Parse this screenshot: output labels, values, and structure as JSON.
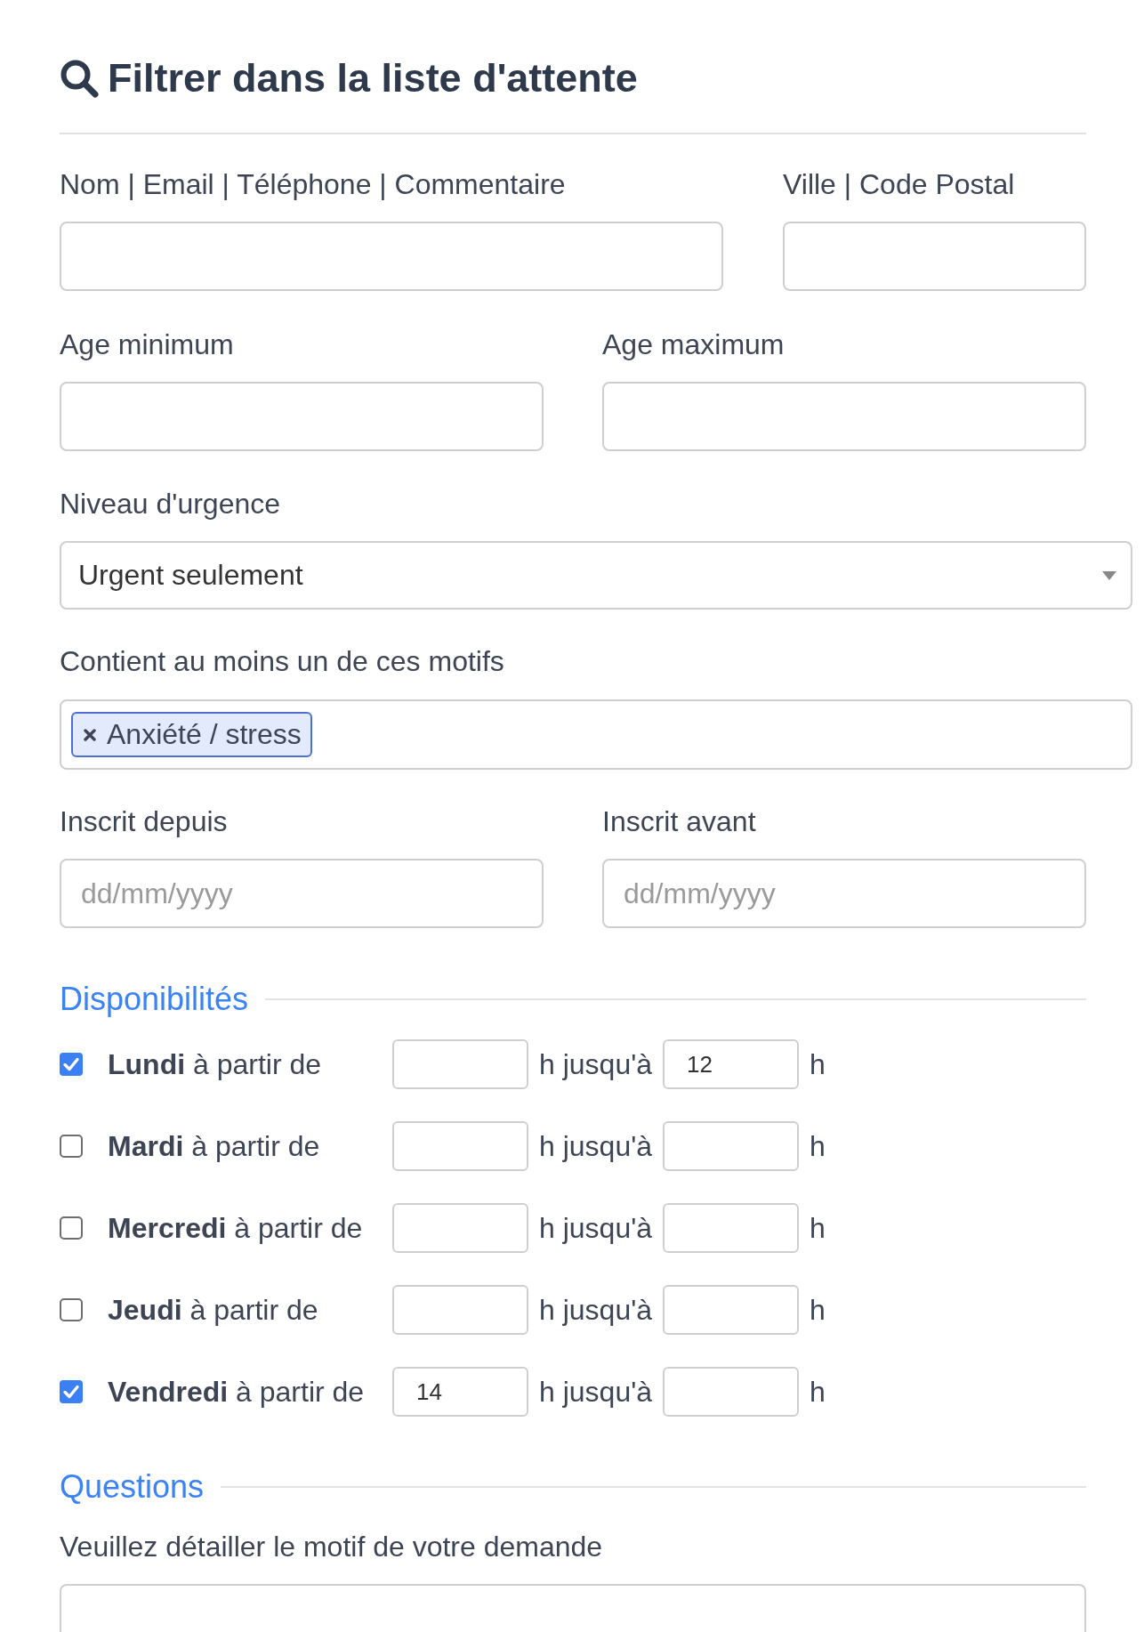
{
  "heading": {
    "title": "Filtrer dans la liste d'attente"
  },
  "search_row": [
    {
      "label": "Nom | Email | Téléphone | Commentaire"
    },
    {
      "label": "Ville | Code Postal"
    }
  ],
  "age_row": [
    {
      "label": "Age minimum"
    },
    {
      "label": "Age maximum"
    }
  ],
  "urgency": {
    "label": "Niveau d'urgence",
    "value": "Urgent seulement"
  },
  "motifs": {
    "label": "Contient au moins un de ces motifs",
    "tags": [
      {
        "text": "Anxiété / stress"
      }
    ]
  },
  "date_row": [
    {
      "label": "Inscrit depuis",
      "placeholder": "dd/mm/yyyy"
    },
    {
      "label": "Inscrit avant",
      "placeholder": "dd/mm/yyyy"
    }
  ],
  "availability": {
    "title": "Disponibilités",
    "days": [
      {
        "checked": true,
        "label": "**Lundi** à partir de",
        "until_label": "h jusqu'à",
        "end": "12",
        "unit": "h"
      },
      {
        "checked": false,
        "label": "**Mardi** à partir de",
        "until_label": "h jusqu'à",
        "unit": "h"
      },
      {
        "checked": false,
        "label": "**Mercredi** à partir de",
        "until_label": "h jusqu'à",
        "unit": "h"
      },
      {
        "checked": false,
        "label": "**Jeudi** à partir de",
        "until_label": "h jusqu'à",
        "unit": "h"
      },
      {
        "checked": true,
        "label": "**Vendredi** à partir de",
        "start": "14",
        "until_label": "h jusqu'à",
        "unit": "h"
      }
    ]
  },
  "questions": {
    "title": "Questions",
    "fields": [
      {
        "label": "Veuillez détailler le motif de votre demande"
      }
    ]
  }
}
